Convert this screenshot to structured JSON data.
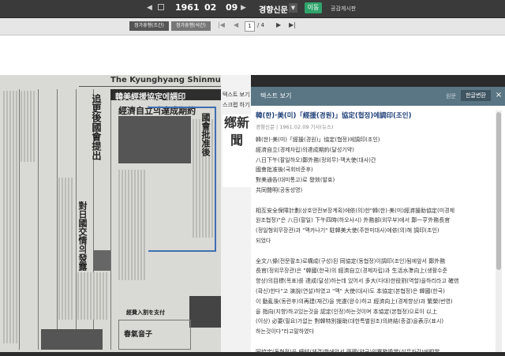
{
  "topbar": {
    "date": {
      "year": "1961",
      "month": "02",
      "day": "09"
    },
    "newspaper": "경향신문",
    "go_label": "이동",
    "board_label": "공감게시판"
  },
  "pagebar": {
    "tabs": [
      "정가휴행(조간)",
      "정가휴행(석간)"
    ],
    "current_page": "1",
    "total_pages": "/ 4"
  },
  "scan": {
    "masthead": "The Kyunghyang Shinmun",
    "band_headline": "韓美經援協定에調印",
    "headline_1": "經濟自立의達成期約",
    "headline_2": "追更後國會提出",
    "headline_3": "對日國交情의發露",
    "headline_4": "國會批准後",
    "headline_5": "經費入割を支付",
    "ad_text": "春氣音子"
  },
  "thumbs": {
    "label_1": "텍스트 보기",
    "label_2": "스크랩 하기",
    "masthead": "鄕新聞"
  },
  "panel": {
    "header": "텍스트 보기",
    "original_label": "원문",
    "convert_label": "한글변환",
    "close_label": "×",
    "title": "韓(한)·美(미)「經援(경원)」協定(협정)에調印(조인)",
    "meta": "경향신문 | 1961.02.09 기사(뉴스)",
    "lines": [
      "韓(한)·美(미)「經援(경원)」協定(협정)에調印(조인)",
      "經濟自立(경제자립)의達成期約(달성기약)",
      "八日下午(팔일하오)鄭外務(정외무)·맥大使(대사)간",
      "國會批准後(국회비준후)",
      "對美通告(대미통고)로 發效(발효)",
      "共同聲明(공동성명)",
      "",
      "相互安全保障計劃(상호안전보장계획)에依(의)한\"韓(한)·美(미)經濟援助協定(미경제",
      "원조협정)\"은 八日(팔일) 下午四時(하오사시) 外務部(외무부)에서 鄭一亨外務長官",
      "(정일형외무장관)과 \"맥카나기\" 駐韓美大使(주한미대사)에依(의)해 調印(조인)",
      "되었다",
      "",
      "全文八條(전문팔조)로構成(구성)된 同協定(동협정)이調印(조인)됨에앞서 鄭外務",
      "長官(정외무장관)은 \"韓國(한국)의 經濟自立(경제자립)과 生活水準向上(생활수준",
      "향상)의目標(목표)를 達成(달성)하는데 있어서 多大(다대)한役割(역할)을하리라고 確信",
      "(확신)한다\"고 演說(연설)하였고 \"맥\" 大使(대사)도 本協定(본협정)은 韓國(한국)",
      "이 動亂後(동란후)의再建(재건)을 完遂(완수)하고 經濟向上(경제향상)과 繁榮(번영)",
      "을 指向(지향)하고있는것을 認定(인정)하는것이며 本協定(본협정)으로이 以上",
      "(이상) 必要(필요)가없는 對韓特別援助(대한특별원조)의終結(종결)을表示(표시)",
      "하는것이다\"라고말하였다",
      "",
      "同協定(동협정)을 締結(체결)함에앞서 兩國(양국)의實務擔當(실무자간)에相當"
    ]
  }
}
